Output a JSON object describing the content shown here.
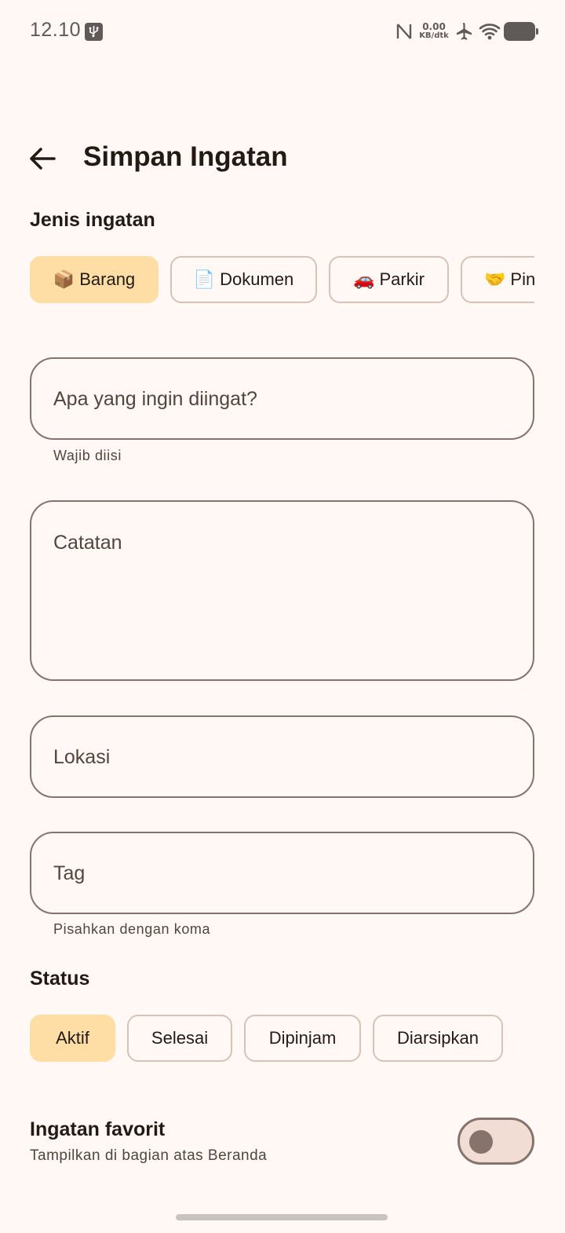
{
  "status_bar": {
    "time": "12.10",
    "net_speed_value": "0.00",
    "net_speed_unit": "KB/dtk"
  },
  "header": {
    "title": "Simpan Ingatan"
  },
  "memory_type": {
    "label": "Jenis ingatan",
    "chips": [
      {
        "emoji": "📦",
        "label": "Barang",
        "selected": true
      },
      {
        "emoji": "📄",
        "label": "Dokumen",
        "selected": false
      },
      {
        "emoji": "🚗",
        "label": "Parkir",
        "selected": false
      },
      {
        "emoji": "🤝",
        "label": "Pinjam",
        "selected": false
      }
    ]
  },
  "fields": {
    "what": {
      "placeholder": "Apa yang ingin diingat?",
      "helper": "Wajib diisi"
    },
    "notes": {
      "placeholder": "Catatan"
    },
    "location": {
      "placeholder": "Lokasi"
    },
    "tags": {
      "placeholder": "Tag",
      "helper": "Pisahkan dengan koma"
    }
  },
  "status": {
    "label": "Status",
    "chips": [
      {
        "label": "Aktif",
        "selected": true
      },
      {
        "label": "Selesai",
        "selected": false
      },
      {
        "label": "Dipinjam",
        "selected": false
      },
      {
        "label": "Diarsipkan",
        "selected": false
      }
    ]
  },
  "favorite": {
    "title": "Ingatan favorit",
    "subtitle": "Tampilkan di bagian atas Beranda",
    "enabled": false
  },
  "colors": {
    "background": "#fff8f5",
    "selected_chip": "#ffdea6",
    "outline": "#85736c"
  }
}
